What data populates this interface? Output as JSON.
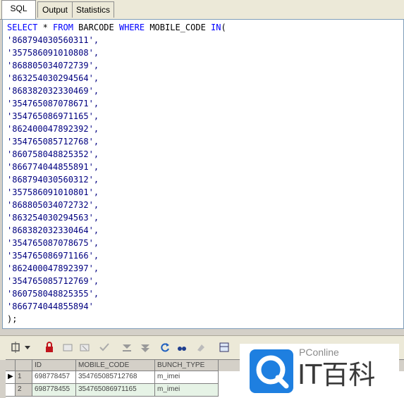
{
  "tabs": [
    {
      "label": "SQL"
    },
    {
      "label": "Output"
    },
    {
      "label": "Statistics"
    }
  ],
  "sql": {
    "select_kw": "SELECT",
    "star": " * ",
    "from_kw": "FROM",
    "table": " BARCODE ",
    "where_kw": "WHERE",
    "column": " MOBILE_CODE ",
    "in_kw": "IN",
    "open_paren": "(",
    "values": [
      "'868794030560311',",
      "'357586091010808',",
      "'868805034072739',",
      "'863254030294564',",
      "'868382032330469',",
      "'354765087078671',",
      "'354765086971165',",
      "'862400047892392',",
      "'354765085712768',",
      "'860758048825352',",
      "'866774044855891',",
      "'868794030560312',",
      "'357586091010801',",
      "'868805034072732',",
      "'863254030294563',",
      "'868382032330464',",
      "'354765087078675',",
      "'354765086971166',",
      "'862400047892397',",
      "'354765085712769',",
      "'860758048825355',",
      "'866774044855894'"
    ],
    "close": ");"
  },
  "grid": {
    "headers": [
      "ID",
      "MOBILE_CODE",
      "BUNCH_TYPE"
    ],
    "rows": [
      {
        "num": "1",
        "id": "698778457",
        "code": "354765085712768",
        "type": "m_imei"
      },
      {
        "num": "2",
        "id": "698778455",
        "code": "354765086971165",
        "type": "m_imei"
      }
    ]
  },
  "watermark": {
    "brand": "PConline",
    "name": "IT百科"
  },
  "colors": {
    "keyword": "#0000ff",
    "string": "#000080",
    "editor_bg": "#ffffff",
    "chrome": "#ece9d8"
  }
}
